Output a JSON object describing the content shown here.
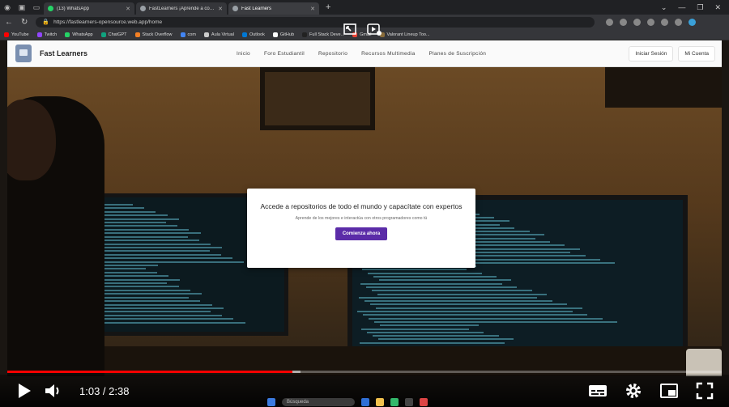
{
  "browser": {
    "tabs": [
      {
        "label": "(13) WhatsApp",
        "color": "#25d366"
      },
      {
        "label": "FastLearners ¡Aprende a codear!",
        "color": "#9aa0a6"
      },
      {
        "label": "Fast Learners",
        "color": "#9aa0a6",
        "active": true
      }
    ],
    "url": "https://fastlearners-opensource.web.app/home",
    "bookmarks": [
      {
        "label": "YouTube",
        "color": "#ff0000"
      },
      {
        "label": "Twitch",
        "color": "#9146ff"
      },
      {
        "label": "WhatsApp",
        "color": "#25d366"
      },
      {
        "label": "ChatGPT",
        "color": "#10a37f"
      },
      {
        "label": "Stack Overflow",
        "color": "#f48024"
      },
      {
        "label": "com",
        "color": "#4285f4"
      },
      {
        "label": "Aula Virtual",
        "color": "#cccccc"
      },
      {
        "label": "Outlook",
        "color": "#0078d4"
      },
      {
        "label": "GitHub",
        "color": "#ffffff"
      },
      {
        "label": "Full Stack Deve...",
        "color": "#222222"
      },
      {
        "label": "Gmail",
        "color": "#ea4335"
      },
      {
        "label": "Valorant Lineup Too...",
        "color": "#8a6d3b"
      }
    ]
  },
  "site": {
    "brand": "Fast Learners",
    "nav_links": [
      "Inicio",
      "Foro Estudiantil",
      "Repositorio",
      "Recursos Multimedia",
      "Planes de Suscripción"
    ],
    "actions": [
      "Iniciar Sesión",
      "Mi Cuenta"
    ],
    "cta": {
      "title": "Accede a repositorios de todo el mundo y capacítate con expertos",
      "subtitle": "Aprende de los mejores e interactúa con otros programadores como tú",
      "button": "Comienza ahora"
    }
  },
  "player": {
    "current_time": "1:03",
    "duration": "2:38",
    "time_display": "1:03 / 2:38",
    "progress_fraction": 0.399,
    "buffer_fraction": 0.41
  },
  "taskbar": {
    "search_placeholder": "Búsqueda"
  }
}
